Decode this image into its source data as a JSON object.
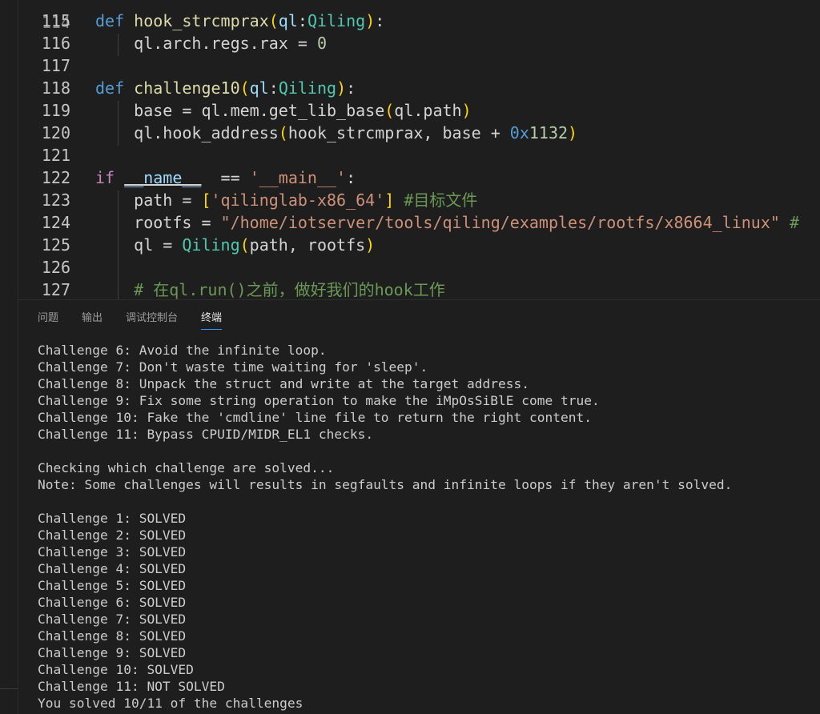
{
  "editor": {
    "partial_top_line_number": "114",
    "lines": [
      {
        "number": "115",
        "segments": [
          {
            "t": "def",
            "c": "kw"
          },
          {
            "t": " ",
            "c": "op"
          },
          {
            "t": "hook_strcmprax",
            "c": "fn"
          },
          {
            "t": "(",
            "c": "b1"
          },
          {
            "t": "ql",
            "c": "param"
          },
          {
            "t": ":",
            "c": "op"
          },
          {
            "t": "Qiling",
            "c": "cls"
          },
          {
            "t": ")",
            "c": "b1"
          },
          {
            "t": ":",
            "c": "op"
          }
        ]
      },
      {
        "number": "116",
        "segments": [
          {
            "t": "    ql.arch.regs.rax = ",
            "c": "op"
          },
          {
            "t": "0",
            "c": "num"
          }
        ]
      },
      {
        "number": "117",
        "segments": []
      },
      {
        "number": "118",
        "segments": [
          {
            "t": "def",
            "c": "kw"
          },
          {
            "t": " ",
            "c": "op"
          },
          {
            "t": "challenge10",
            "c": "fn"
          },
          {
            "t": "(",
            "c": "b1"
          },
          {
            "t": "ql",
            "c": "param"
          },
          {
            "t": ":",
            "c": "op"
          },
          {
            "t": "Qiling",
            "c": "cls"
          },
          {
            "t": ")",
            "c": "b1"
          },
          {
            "t": ":",
            "c": "op"
          }
        ]
      },
      {
        "number": "119",
        "segments": [
          {
            "t": "    base = ql.mem.get_lib_base",
            "c": "op"
          },
          {
            "t": "(",
            "c": "b1"
          },
          {
            "t": "ql.path",
            "c": "op"
          },
          {
            "t": ")",
            "c": "b1"
          }
        ]
      },
      {
        "number": "120",
        "segments": [
          {
            "t": "    ql.hook_address",
            "c": "op"
          },
          {
            "t": "(",
            "c": "b1"
          },
          {
            "t": "hook_strcmprax, base + ",
            "c": "op"
          },
          {
            "t": "0x",
            "c": "kw"
          },
          {
            "t": "1132",
            "c": "num"
          },
          {
            "t": ")",
            "c": "b1"
          }
        ]
      },
      {
        "number": "121",
        "segments": []
      },
      {
        "number": "122",
        "segments": [
          {
            "t": "if",
            "c": "kw-ctl"
          },
          {
            "t": " ",
            "c": "op"
          },
          {
            "t": "__name__",
            "c": "var u"
          },
          {
            "t": "  == ",
            "c": "op"
          },
          {
            "t": "'__main__'",
            "c": "str"
          },
          {
            "t": ":",
            "c": "op"
          }
        ]
      },
      {
        "number": "123",
        "segments": [
          {
            "t": "    path = ",
            "c": "op"
          },
          {
            "t": "[",
            "c": "b1"
          },
          {
            "t": "'qilinglab-x86_64'",
            "c": "str"
          },
          {
            "t": "]",
            "c": "b1"
          },
          {
            "t": " #目标文件",
            "c": "cmt"
          }
        ]
      },
      {
        "number": "124",
        "segments": [
          {
            "t": "    rootfs = ",
            "c": "op"
          },
          {
            "t": "\"/home/iotserver/tools/qiling/examples/rootfs/x8664_linux\"",
            "c": "str"
          },
          {
            "t": " #",
            "c": "cmt"
          }
        ]
      },
      {
        "number": "125",
        "segments": [
          {
            "t": "    ql = ",
            "c": "op"
          },
          {
            "t": "Qiling",
            "c": "cls"
          },
          {
            "t": "(",
            "c": "b1"
          },
          {
            "t": "path, rootfs",
            "c": "op"
          },
          {
            "t": ")",
            "c": "b1"
          }
        ]
      },
      {
        "number": "126",
        "segments": []
      },
      {
        "number": "127",
        "segments": [
          {
            "t": "    # 在ql.run()之前，做好我们的hook工作",
            "c": "cmt"
          }
        ]
      }
    ]
  },
  "panel": {
    "tabs": [
      {
        "label": "问题",
        "name": "tab-problems",
        "active": false
      },
      {
        "label": "输出",
        "name": "tab-output",
        "active": false
      },
      {
        "label": "调试控制台",
        "name": "tab-debug-console",
        "active": false
      },
      {
        "label": "终端",
        "name": "tab-terminal",
        "active": true
      }
    ]
  },
  "terminal": {
    "lines": [
      "Challenge 6: Avoid the infinite loop.",
      "Challenge 7: Don't waste time waiting for 'sleep'.",
      "Challenge 8: Unpack the struct and write at the target address.",
      "Challenge 9: Fix some string operation to make the iMpOsSiBlE come true.",
      "Challenge 10: Fake the 'cmdline' line file to return the right content.",
      "Challenge 11: Bypass CPUID/MIDR_EL1 checks.",
      "",
      "Checking which challenge are solved...",
      "Note: Some challenges will results in segfaults and infinite loops if they aren't solved.",
      "",
      "Challenge 1: SOLVED",
      "Challenge 2: SOLVED",
      "Challenge 3: SOLVED",
      "Challenge 4: SOLVED",
      "Challenge 5: SOLVED",
      "Challenge 6: SOLVED",
      "Challenge 7: SOLVED",
      "Challenge 8: SOLVED",
      "Challenge 9: SOLVED",
      "Challenge 10: SOLVED",
      "Challenge 11: NOT SOLVED",
      "You solved 10/11 of the challenges"
    ]
  }
}
